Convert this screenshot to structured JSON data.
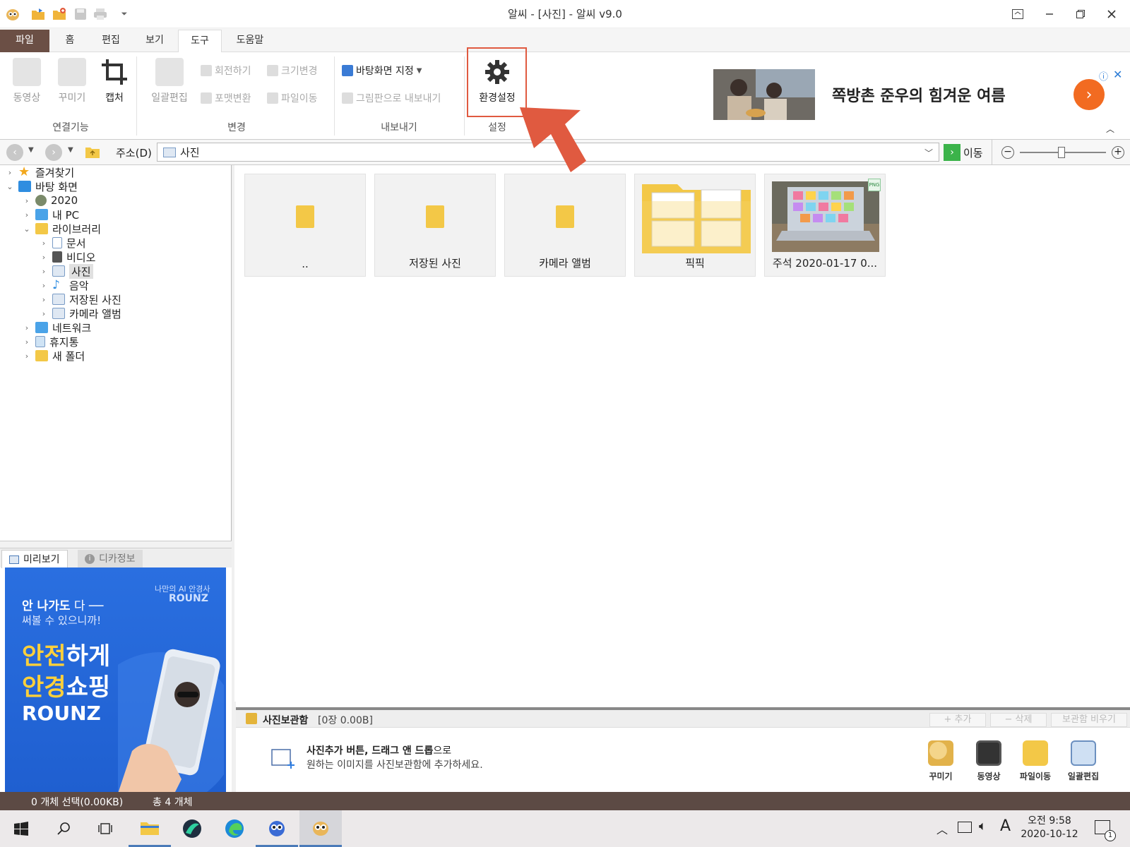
{
  "window": {
    "title": "알씨 - [사진] - 알씨 v9.0",
    "quick_access": [
      "app-logo-icon",
      "open-folder-icon",
      "new-folder-icon",
      "save-icon",
      "print-icon",
      "customize-dropdown-icon"
    ],
    "controls": [
      "ribbon-display-icon",
      "minimize-icon",
      "restore-icon",
      "close-icon"
    ]
  },
  "menu_tabs": [
    {
      "label": "파일"
    },
    {
      "label": "홈"
    },
    {
      "label": "편집"
    },
    {
      "label": "보기"
    },
    {
      "label": "도구",
      "active": true
    },
    {
      "label": "도움말"
    }
  ],
  "ribbon": {
    "group_link": {
      "name": "연결기능",
      "video": "동영상",
      "decorate": "꾸미기",
      "capture": "캡처"
    },
    "group_change": {
      "name": "변경",
      "batch_edit": "일괄편집",
      "rotate": "회전하기",
      "resize": "크기변경",
      "format_convert": "포맷변환",
      "file_move": "파일이동"
    },
    "group_export": {
      "name": "내보내기",
      "wallpaper": "바탕화면 지정",
      "export_paint": "그림판으로 내보내기"
    },
    "group_settings": {
      "name": "설정",
      "preferences": "환경설정"
    }
  },
  "ad_banner": {
    "text": "쪽방촌 준우의 힘겨운 여름"
  },
  "address": {
    "label": "주소(D)",
    "path": "사진",
    "go": "이동"
  },
  "tree": {
    "items": [
      {
        "label": "즐겨찾기",
        "icon": "star-icon",
        "level": 0,
        "expanded": false
      },
      {
        "label": "바탕 화면",
        "icon": "desktop-icon",
        "level": 0,
        "expanded": true
      },
      {
        "label": "2020",
        "icon": "user-icon",
        "level": 1,
        "expanded": false
      },
      {
        "label": "내 PC",
        "icon": "pc-icon",
        "level": 1,
        "expanded": false
      },
      {
        "label": "라이브러리",
        "icon": "library-icon",
        "level": 1,
        "expanded": true
      },
      {
        "label": "문서",
        "icon": "document-icon",
        "level": 2,
        "expanded": false
      },
      {
        "label": "비디오",
        "icon": "video-icon",
        "level": 2,
        "expanded": false
      },
      {
        "label": "사진",
        "icon": "picture-icon",
        "level": 2,
        "expanded": false,
        "selected": true
      },
      {
        "label": "음악",
        "icon": "music-icon",
        "level": 2,
        "expanded": false
      },
      {
        "label": "저장된 사진",
        "icon": "picture-icon",
        "level": 2,
        "expanded": false
      },
      {
        "label": "카메라 앨범",
        "icon": "picture-icon",
        "level": 2,
        "expanded": false
      },
      {
        "label": "네트워크",
        "icon": "network-icon",
        "level": 1,
        "expanded": false
      },
      {
        "label": "휴지통",
        "icon": "recycle-bin-icon",
        "level": 1,
        "expanded": false
      },
      {
        "label": "새 폴더",
        "icon": "folder-icon",
        "level": 1,
        "expanded": false
      }
    ]
  },
  "preview": {
    "tabs": [
      {
        "label": "미리보기",
        "active": true
      },
      {
        "label": "디카정보",
        "active": false
      }
    ],
    "ad": {
      "tagline": "나만의 AI 안경사",
      "brand_top": "ROUNZ",
      "line1_bold": "안 나가도",
      "line1_rest": " 다 ──",
      "line2": "써볼 수 있으니까!",
      "headline1_a": "안전",
      "headline1_b": "하게",
      "headline2_a": "안경",
      "headline2_b": "쇼핑",
      "brand_bottom": "ROUNZ"
    }
  },
  "content": {
    "items": [
      {
        "label": "..",
        "type": "folder"
      },
      {
        "label": "저장된 사진",
        "type": "folder"
      },
      {
        "label": "카메라 앨범",
        "type": "folder"
      },
      {
        "label": "픽픽",
        "type": "folder-thumb"
      },
      {
        "label": "주석 2020-01-17 0...",
        "type": "image",
        "badge": "PNG"
      }
    ]
  },
  "collection": {
    "title": "사진보관함",
    "count": "[0장 0.00B]",
    "add": "+ 추가",
    "delete": "− 삭제",
    "clear": "보관함 비우기",
    "hint_bold": "사진추가 버튼, 드래그 앤 드롭",
    "hint_rest": "으로",
    "hint_line2": "원하는 이미지를 사진보관함에 추가하세요.",
    "actions": [
      "꾸미기",
      "동영상",
      "파일이동",
      "일괄편집"
    ]
  },
  "status": {
    "selected": "0 개체 선택(0.00KB)",
    "total": "총 4 개체"
  },
  "taskbar": {
    "time": "오전 9:58",
    "date": "2020-10-12",
    "ime": "A",
    "notif_count": "1",
    "apps": [
      "start-icon",
      "search-icon",
      "task-view-icon",
      "file-explorer-icon",
      "app-green-icon",
      "edge-icon",
      "alcapture-icon",
      "alsee-icon"
    ]
  },
  "colors": {
    "file_tab": "#6b4f45",
    "status_bar": "#5c4a44",
    "highlight": "#e05a40",
    "ad_blue": "#2a6fe0",
    "ad_orange": "#f26b21"
  }
}
